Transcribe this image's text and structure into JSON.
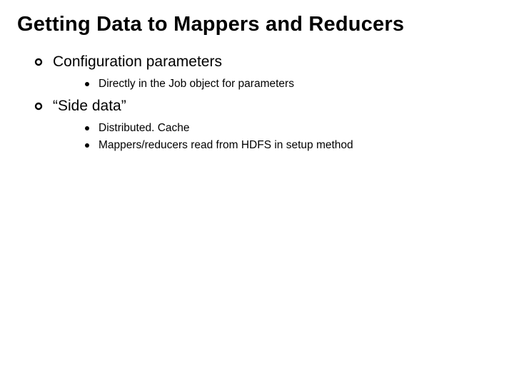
{
  "title": "Getting Data to Mappers and Reducers",
  "items": [
    {
      "text": "Configuration parameters",
      "sub": [
        "Directly in the Job object for parameters"
      ]
    },
    {
      "text": "“Side data”",
      "sub": [
        "Distributed. Cache",
        "Mappers/reducers read from HDFS in setup method"
      ]
    }
  ]
}
